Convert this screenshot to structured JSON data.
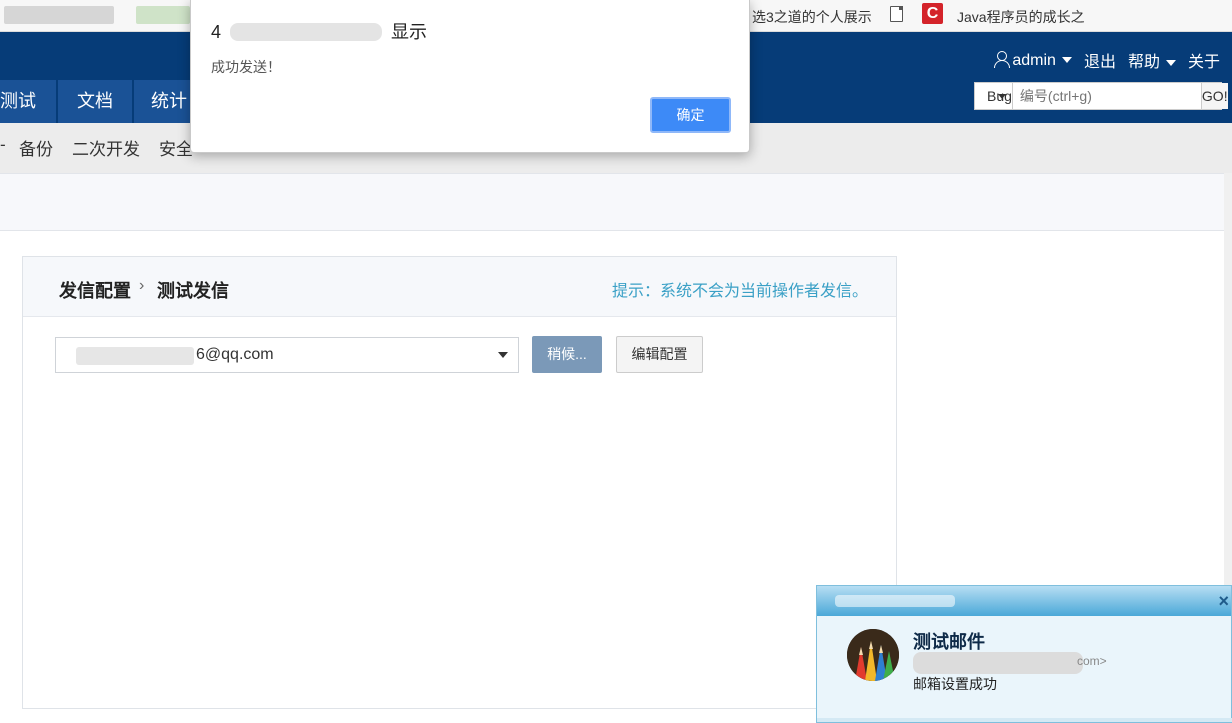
{
  "bookmarks": {
    "item1": "选3之道的个人展示",
    "item2": "Java程序员的成长之"
  },
  "header": {
    "user": "admin",
    "logout": "退出",
    "help": "帮助",
    "about": "关于"
  },
  "nav": {
    "tabs": [
      "测试",
      "文档",
      "统计"
    ]
  },
  "search": {
    "type": "Bug",
    "placeholder": "编号(ctrl+g)",
    "go": "GO!"
  },
  "subnav": {
    "items": [
      "备份",
      "二次开发",
      "安全"
    ]
  },
  "panel": {
    "breadcrumb_parent": "发信配置",
    "breadcrumb_sep": "›",
    "breadcrumb_current": "测试发信",
    "tip": "提示：系统不会为当前操作者发信。",
    "email_value": "6@qq.com",
    "wait_button": "稍候...",
    "edit_button": "编辑配置"
  },
  "alert": {
    "title_prefix": "4",
    "title_suffix": "显示",
    "message": "成功发送！",
    "ok": "确定"
  },
  "toast": {
    "close": "×",
    "subject": "测试邮件",
    "from_suffix": "com>",
    "body": "邮箱设置成功"
  }
}
